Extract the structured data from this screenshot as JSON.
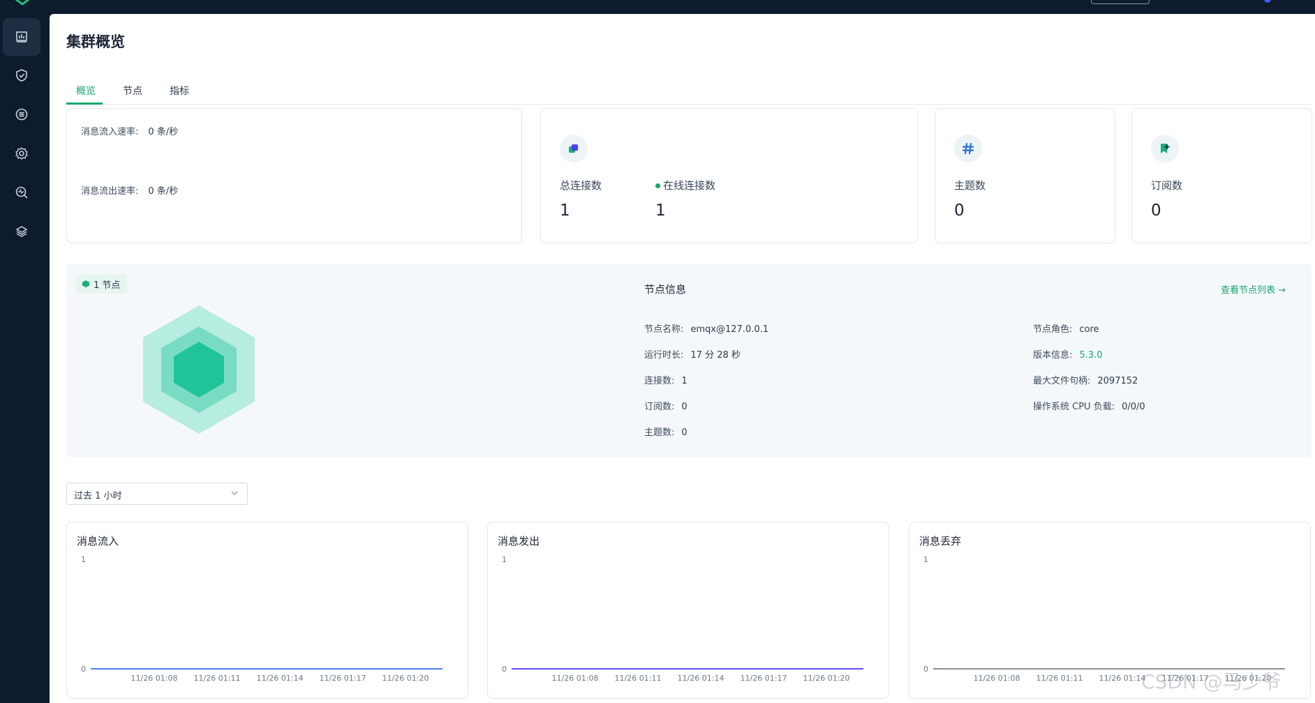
{
  "colors": {
    "accent": "#13a86b",
    "sidebar": "#0d1b2c",
    "chart_line_1": "#4a7df0",
    "chart_line_2": "#5b4ff0",
    "chart_line_3": "#8a8f96"
  },
  "sidebar": {
    "items": [
      {
        "icon": "dashboard-icon",
        "active": true
      },
      {
        "icon": "shield-icon",
        "active": false
      },
      {
        "icon": "list-circle-icon",
        "active": false
      },
      {
        "icon": "gear-icon",
        "active": false
      },
      {
        "icon": "diagnose-icon",
        "active": false
      },
      {
        "icon": "layers-icon",
        "active": false
      }
    ]
  },
  "page": {
    "title": "集群概览"
  },
  "tabs": [
    {
      "label": "概览",
      "active": true
    },
    {
      "label": "节点",
      "active": false
    },
    {
      "label": "指标",
      "active": false
    }
  ],
  "rates": {
    "in_label": "消息流入速率:",
    "in_value": "0 条/秒",
    "out_label": "消息流出速率:",
    "out_value": "0 条/秒"
  },
  "connections": {
    "total_label": "总连接数",
    "total_value": "1",
    "online_label": "在线连接数",
    "online_value": "1"
  },
  "topics": {
    "label": "主题数",
    "value": "0"
  },
  "subscriptions": {
    "label": "订阅数",
    "value": "0"
  },
  "node": {
    "badge": "1 节点",
    "info_title": "节点信息",
    "link": "查看节点列表 →",
    "left": [
      {
        "label": "节点名称:",
        "value": "emqx@127.0.0.1"
      },
      {
        "label": "运行时长:",
        "value": "17 分 28 秒"
      },
      {
        "label": "连接数:",
        "value": "1"
      },
      {
        "label": "订阅数:",
        "value": "0"
      },
      {
        "label": "主题数:",
        "value": "0"
      }
    ],
    "right": [
      {
        "label": "节点角色:",
        "value": "core"
      },
      {
        "label": "版本信息:",
        "value": "5.3.0"
      },
      {
        "label": "最大文件句柄:",
        "value": "2097152"
      },
      {
        "label": "操作系统 CPU 负载:",
        "value": "0/0/0"
      }
    ]
  },
  "time_range": {
    "value": "过去 1 小时"
  },
  "chart_data": [
    {
      "type": "line",
      "title": "消息流入",
      "x": [
        "11/26 01:08",
        "11/26 01:11",
        "11/26 01:14",
        "11/26 01:17",
        "11/26 01:20"
      ],
      "series": [
        {
          "values": [
            0,
            0,
            0,
            0,
            0
          ]
        }
      ],
      "ylim": [
        0,
        1
      ],
      "yticks": [
        "0",
        "1"
      ]
    },
    {
      "type": "line",
      "title": "消息发出",
      "x": [
        "11/26 01:08",
        "11/26 01:11",
        "11/26 01:14",
        "11/26 01:17",
        "11/26 01:20"
      ],
      "series": [
        {
          "values": [
            0,
            0,
            0,
            0,
            0
          ]
        }
      ],
      "ylim": [
        0,
        1
      ],
      "yticks": [
        "0",
        "1"
      ]
    },
    {
      "type": "line",
      "title": "消息丢弃",
      "x": [
        "11/26 01:08",
        "11/26 01:11",
        "11/26 01:14",
        "11/26 01:17",
        "11/26 01:20"
      ],
      "series": [
        {
          "values": [
            0,
            0,
            0,
            0,
            0
          ]
        }
      ],
      "ylim": [
        0,
        1
      ],
      "yticks": [
        "0",
        "1"
      ]
    }
  ],
  "watermark": "CSDN @马少爷"
}
